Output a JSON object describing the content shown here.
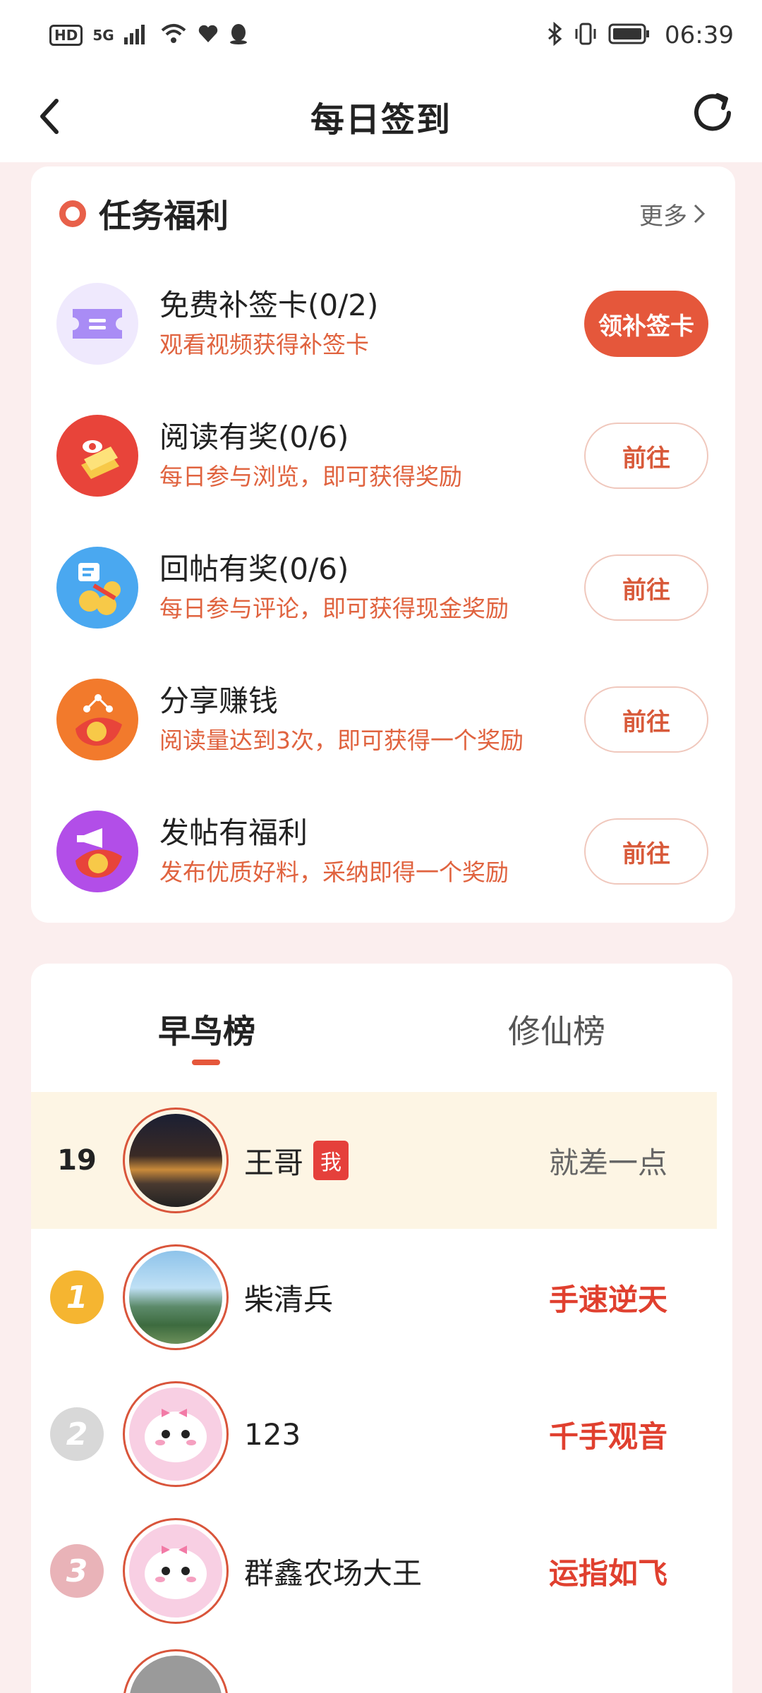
{
  "status_bar": {
    "hd": "HD",
    "signal": "5G",
    "time": "06:39",
    "icons": [
      "wifi-icon",
      "heart-icon",
      "qq-icon",
      "bluetooth-icon",
      "vibrate-icon",
      "battery-icon"
    ]
  },
  "nav": {
    "title": "每日签到",
    "back_icon": "chevron-left-icon",
    "refresh_icon": "refresh-icon"
  },
  "tasks": {
    "title": "任务福利",
    "more_label": "更多",
    "items": [
      {
        "title": "免费补签卡(0/2)",
        "subtitle": "观看视频获得补签卡",
        "button": "领补签卡",
        "icon": "ticket-icon",
        "accent": "#a98cf5"
      },
      {
        "title": "阅读有奖(0/6)",
        "subtitle": "每日参与浏览，即可获得奖励",
        "button": "前往",
        "icon": "read-icon",
        "accent": "#e8443a"
      },
      {
        "title": "回帖有奖(0/6)",
        "subtitle": "每日参与评论，即可获得现金奖励",
        "button": "前往",
        "icon": "reply-icon",
        "accent": "#4aa8f0"
      },
      {
        "title": "分享赚钱",
        "subtitle": "阅读量达到3次，即可获得一个奖励",
        "button": "前往",
        "icon": "share-icon",
        "accent": "#f27a2c"
      },
      {
        "title": "发帖有福利",
        "subtitle": "发布优质好料，采纳即得一个奖励",
        "button": "前往",
        "icon": "post-icon",
        "accent": "#b24ee8"
      }
    ]
  },
  "ranking": {
    "tabs": [
      "早鸟榜",
      "修仙榜"
    ],
    "active_tab": "早鸟榜",
    "me": {
      "rank": "19",
      "name": "王哥",
      "badge": "我",
      "status": "就差一点"
    },
    "rows": [
      {
        "rank": "1",
        "name": "柴清兵",
        "status": "手速逆天",
        "medal_color": "#f5b531"
      },
      {
        "rank": "2",
        "name": "123",
        "status": "千手观音",
        "medal_color": "#d8d8d8"
      },
      {
        "rank": "3",
        "name": "群鑫农场大王",
        "status": "运指如飞",
        "medal_color": "#e9b3b8"
      }
    ]
  }
}
